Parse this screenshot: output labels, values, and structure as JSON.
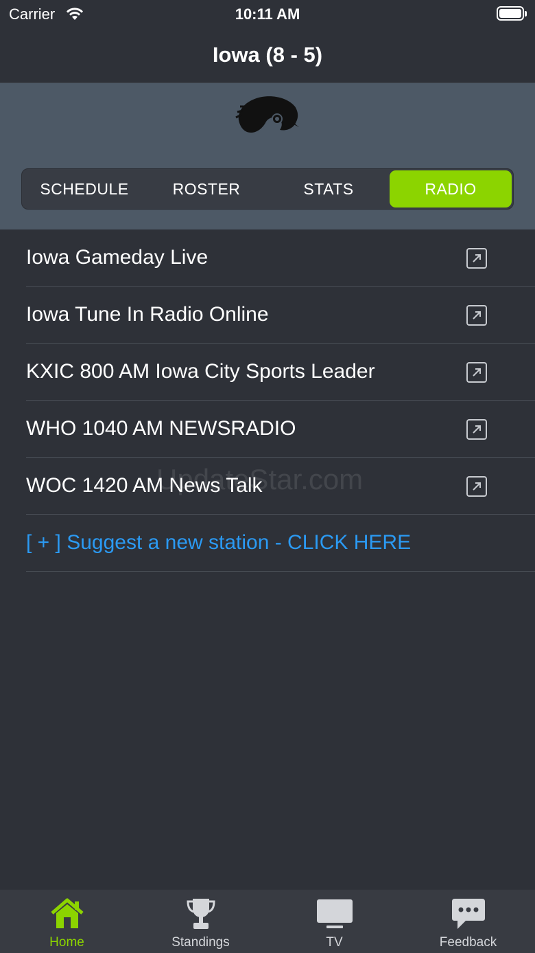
{
  "status_bar": {
    "carrier": "Carrier",
    "time": "10:11 AM"
  },
  "nav": {
    "title": "Iowa (8 - 5)"
  },
  "segments": [
    {
      "label": "SCHEDULE"
    },
    {
      "label": "ROSTER"
    },
    {
      "label": "STATS"
    },
    {
      "label": "RADIO"
    }
  ],
  "stations": [
    {
      "label": "Iowa Gameday Live"
    },
    {
      "label": "Iowa Tune In Radio Online"
    },
    {
      "label": "KXIC 800 AM Iowa City Sports Leader"
    },
    {
      "label": "WHO 1040 AM NEWSRADIO"
    },
    {
      "label": "WOC 1420 AM News Talk"
    }
  ],
  "suggest": {
    "label": "[ + ] Suggest a new station - CLICK HERE"
  },
  "watermark": "UpdateStar.com",
  "tabs": [
    {
      "label": "Home",
      "icon": "home-icon"
    },
    {
      "label": "Standings",
      "icon": "trophy-icon"
    },
    {
      "label": "TV",
      "icon": "tv-icon"
    },
    {
      "label": "Feedback",
      "icon": "chat-bubble-icon"
    }
  ],
  "colors": {
    "accent": "#8cd400",
    "link": "#2b9af3",
    "background": "#2e3138",
    "header": "#4d5966"
  }
}
